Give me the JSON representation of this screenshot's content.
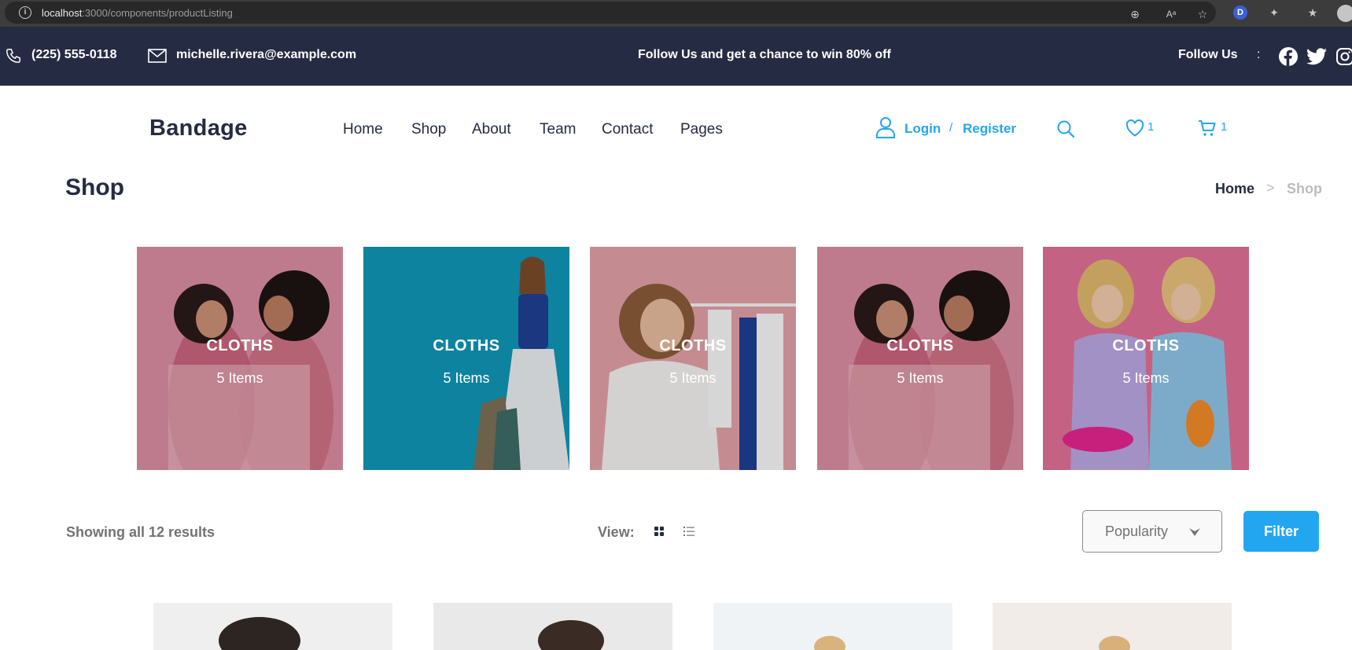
{
  "browser": {
    "url_host": "localhost",
    "url_path": ":3000/components/productListing",
    "extension_letter": "D"
  },
  "topbar": {
    "phone": "(225) 555-0118",
    "email": "michelle.rivera@example.com",
    "promo": "Follow Us  and get a chance to win 80% off",
    "follow_label": "Follow Us",
    "separator": ":",
    "social_icons": [
      "facebook-icon",
      "twitter-icon",
      "instagram-icon"
    ]
  },
  "header": {
    "logo": "Bandage",
    "nav": [
      "Home",
      "Shop",
      "About",
      "Team",
      "Contact",
      "Pages"
    ],
    "login": "Login",
    "slash": "/",
    "register": "Register",
    "wishlist_count": "1",
    "cart_count": "1"
  },
  "page": {
    "title": "Shop",
    "breadcrumb": {
      "home": "Home",
      "separator": ">",
      "current": "Shop"
    }
  },
  "categories": [
    {
      "title": "CLOTHS",
      "count": "5 Items",
      "bg": "#d98ca2"
    },
    {
      "title": "CLOTHS",
      "count": "5 Items",
      "bg": "#0f96b6"
    },
    {
      "title": "CLOTHS",
      "count": "5 Items",
      "bg": "#e0a0a6"
    },
    {
      "title": "CLOTHS",
      "count": "5 Items",
      "bg": "#d98ca2"
    },
    {
      "title": "CLOTHS",
      "count": "5 Items",
      "bg": "#e07096"
    }
  ],
  "listing": {
    "results_text": "Showing all 12 results",
    "view_label": "View:",
    "sort_selected": "Popularity",
    "filter_label": "Filter"
  },
  "colors": {
    "primary": "#23a6f0",
    "dark": "#252b42",
    "muted": "#737373"
  }
}
